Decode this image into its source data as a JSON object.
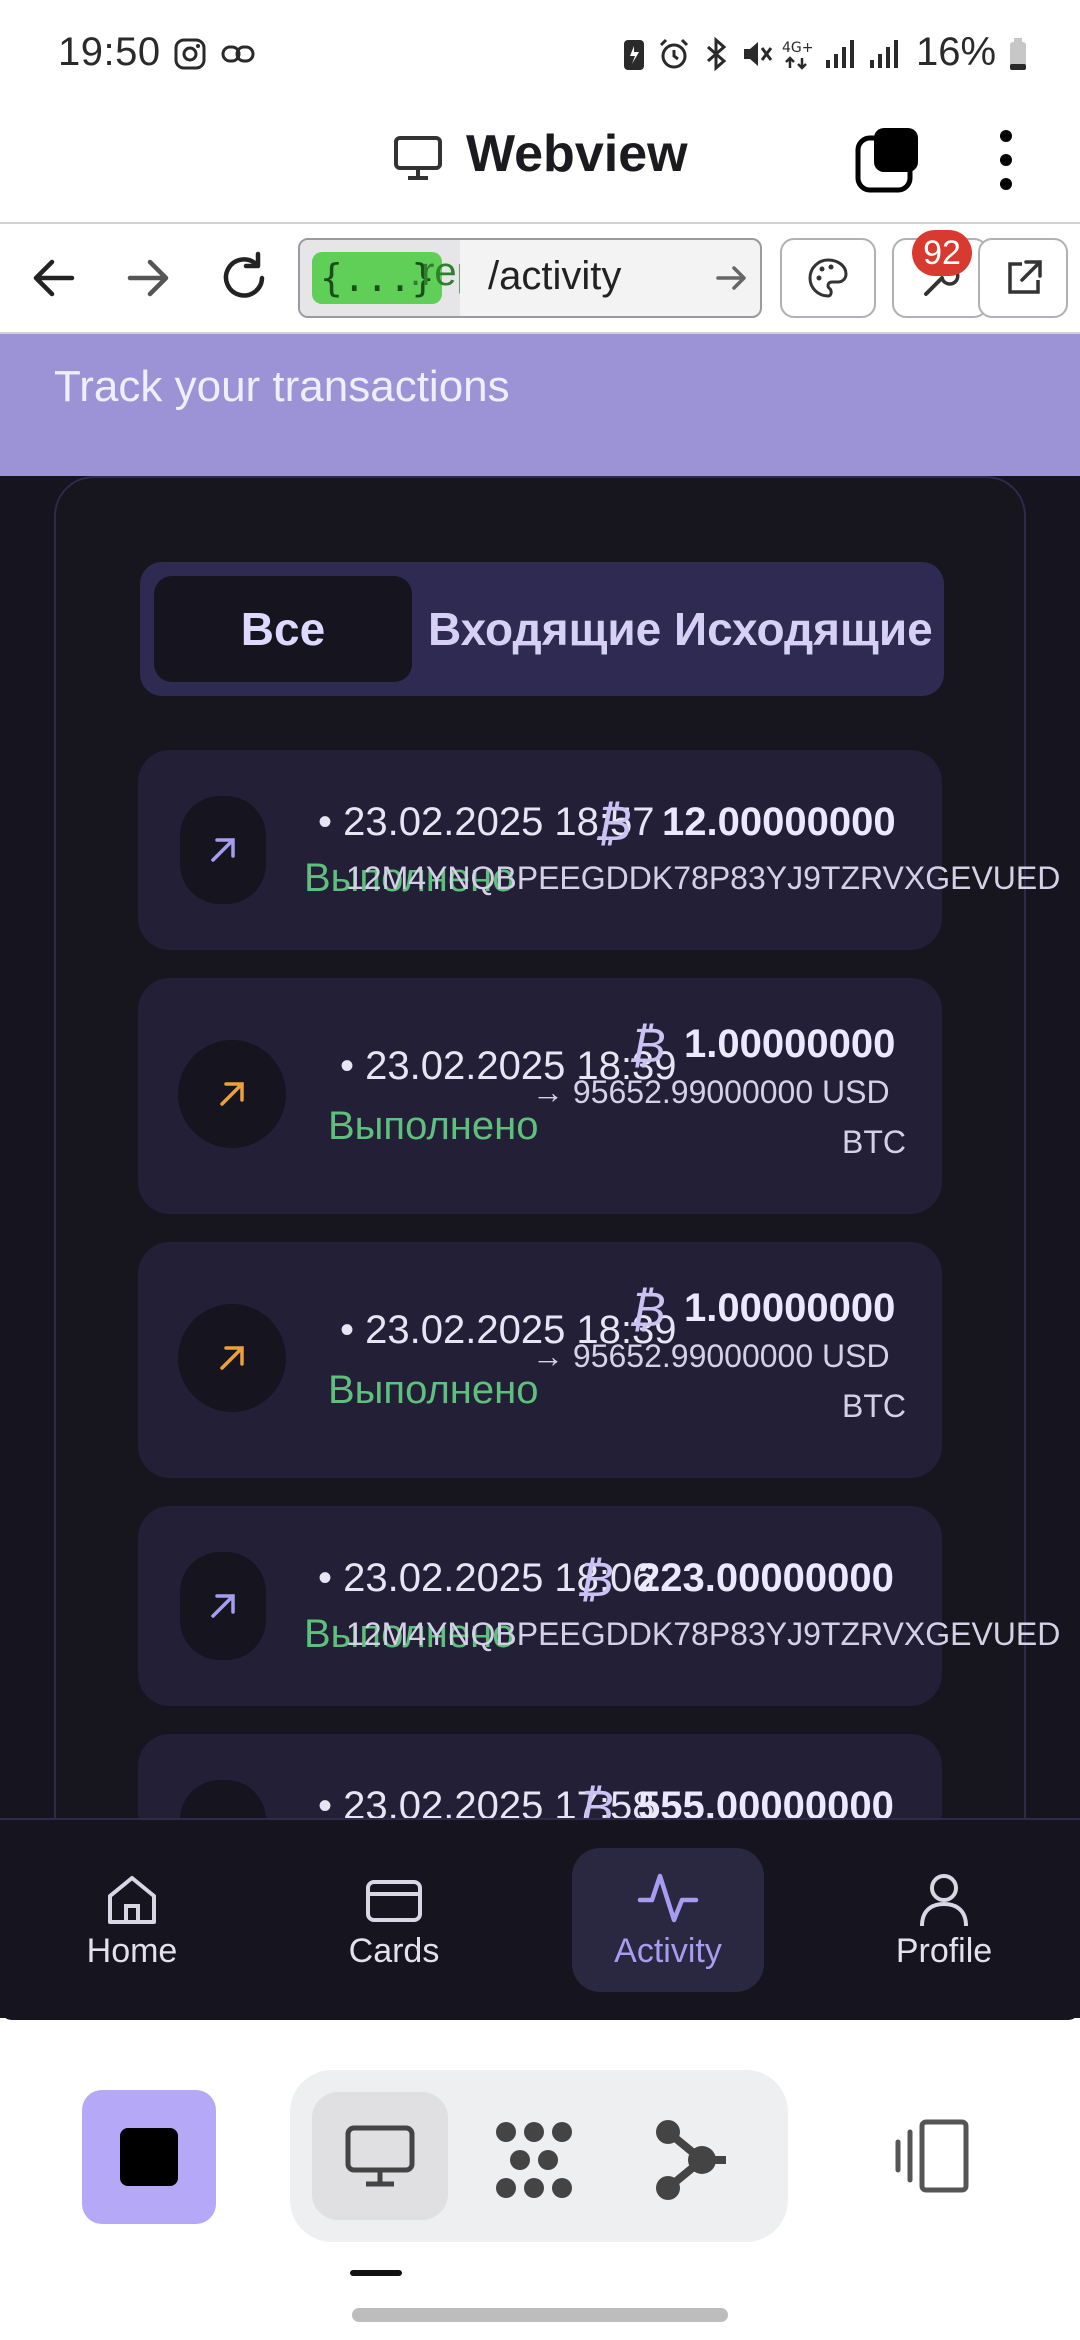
{
  "status_bar": {
    "time": "19:50",
    "battery": "16%",
    "icons": [
      "instagram-icon",
      "link-icon",
      "battery-saver-icon",
      "alarm-icon",
      "bluetooth-icon",
      "mute-icon",
      "4g-icon",
      "signal-icon",
      "signal-icon",
      "battery-icon"
    ]
  },
  "webview": {
    "title": "Webview",
    "tab_icon": "tabs-icon",
    "menu_icon": "more-vert-icon"
  },
  "toolbar": {
    "url_origin_pill": "{...}",
    "url_origin_rest": ".rep",
    "url_path": "/activity",
    "badge_count": "92"
  },
  "app": {
    "banner_subtitle": "Track your transactions",
    "filters": {
      "all": "Все",
      "incoming": "Входящие",
      "outgoing": "Исходящие",
      "selected": "all"
    },
    "transactions": [
      {
        "date": "• 23.02.2025 18:57",
        "status": "Выполнено",
        "amount": "12.00000000",
        "sub1": "12M4YNQBPEEGDDK78P83YJ9TZRVXGEVUED",
        "sub2": "",
        "icon_color": "#a79df0",
        "direction": "outgoing"
      },
      {
        "date": "• 23.02.2025 18:39",
        "status": "Выполнено",
        "amount": "1.00000000",
        "sub1": "→ 95652.99000000 USD",
        "sub2": "BTC",
        "icon_color": "#e9a23b",
        "direction": "exchange"
      },
      {
        "date": "• 23.02.2025 18:39",
        "status": "Выполнено",
        "amount": "1.00000000",
        "sub1": "→ 95652.99000000 USD",
        "sub2": "BTC",
        "icon_color": "#e9a23b",
        "direction": "exchange"
      },
      {
        "date": "• 23.02.2025 18:06",
        "status": "Выполнено",
        "amount": "223.00000000",
        "sub1": "12M4YNQBPEEGDDK78P83YJ9TZRVXGEVUED",
        "sub2": "",
        "icon_color": "#a79df0",
        "direction": "outgoing"
      },
      {
        "date": "• 23.02.2025 17:58",
        "status": "",
        "amount": "555.00000000",
        "sub1": "",
        "sub2": "",
        "icon_color": "#a79df0",
        "direction": "outgoing"
      }
    ],
    "currency_symbol": "₿"
  },
  "bottom_nav": {
    "items": [
      {
        "label": "Home",
        "icon": "home-icon"
      },
      {
        "label": "Cards",
        "icon": "card-icon"
      },
      {
        "label": "Activity",
        "icon": "activity-icon",
        "active": true
      },
      {
        "label": "Profile",
        "icon": "user-icon"
      }
    ]
  },
  "colors": {
    "banner": "#9b93d6",
    "app_background": "#15141f",
    "card": "#221f37",
    "accent": "#a79df0",
    "success": "#5fbf7d",
    "stop_button": "#b5a9f7"
  }
}
